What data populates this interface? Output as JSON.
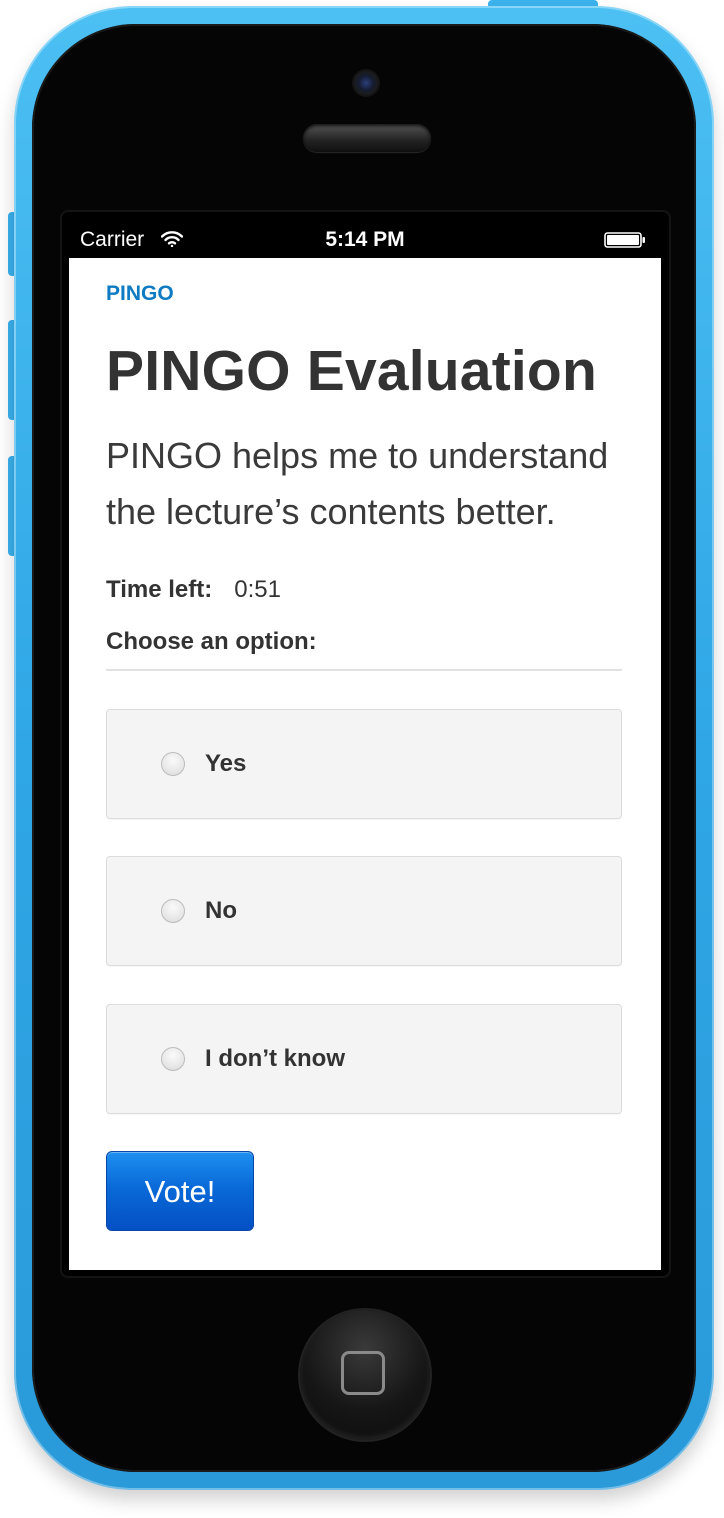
{
  "status_bar": {
    "carrier": "Carrier",
    "time": "5:14 PM",
    "wifi_icon": "wifi-icon",
    "battery_icon": "battery-icon"
  },
  "header": {
    "app_link": "PINGO",
    "title": "PINGO Evaluation"
  },
  "question": {
    "text": "PINGO helps me to understand the lecture’s contents better."
  },
  "timer": {
    "label": "Time left:",
    "value": "0:51"
  },
  "options": {
    "prompt": "Choose an option:",
    "items": [
      {
        "label": "Yes",
        "selected": false
      },
      {
        "label": "No",
        "selected": false
      },
      {
        "label": "I don’t know",
        "selected": false
      }
    ]
  },
  "actions": {
    "vote_label": "Vote!"
  },
  "colors": {
    "brand_link": "#0f7bc3",
    "vote_button": "#0a6ad8",
    "device_shell": "#2fa6e6"
  }
}
